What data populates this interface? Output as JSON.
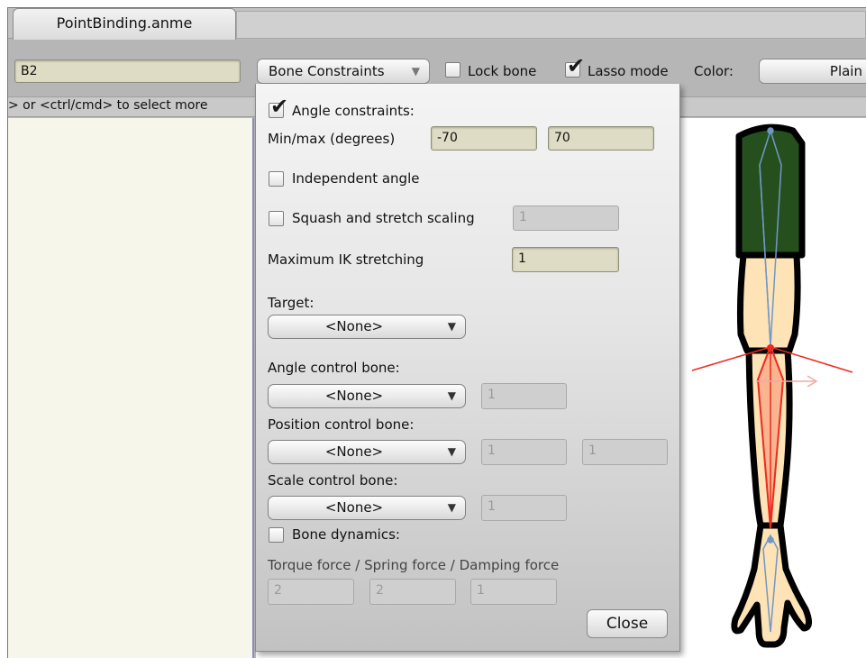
{
  "tab": {
    "title": "PointBinding.anme"
  },
  "toolbar": {
    "bone_name": "B2",
    "mode_dropdown": "Bone Constraints",
    "lock_bone_label": "Lock bone",
    "lock_bone_checked": false,
    "lasso_label": "Lasso mode",
    "lasso_checked": true,
    "color_label": "Color:",
    "color_value": "Plain"
  },
  "hint": "> or <ctrl/cmd> to select more",
  "popup": {
    "angle_constraints_label": "Angle constraints:",
    "angle_constraints_checked": true,
    "minmax_label": "Min/max (degrees)",
    "min_value": "-70",
    "max_value": "70",
    "independent_angle_label": "Independent angle",
    "squash_label": "Squash and stretch scaling",
    "squash_value": "1",
    "max_ik_label": "Maximum IK stretching",
    "max_ik_value": "1",
    "target_label": "Target:",
    "target_value": "<None>",
    "angle_control_label": "Angle control bone:",
    "angle_control_value": "<None>",
    "angle_control_num": "1",
    "position_control_label": "Position control bone:",
    "position_control_value": "<None>",
    "position_control_num1": "1",
    "position_control_num2": "1",
    "scale_control_label": "Scale control bone:",
    "scale_control_value": "<None>",
    "scale_control_num": "1",
    "bone_dynamics_label": "Bone dynamics:",
    "forces_label": "Torque force / Spring force / Damping force",
    "torque_value": "2",
    "spring_value": "2",
    "damping_value": "1",
    "close_label": "Close"
  },
  "colors": {
    "field_bg": "#dedcc4",
    "sleeve_green": "#25501d",
    "skin": "#fde3b6",
    "bone_blue": "#6f98c8",
    "bone_red": "#ee2a1f"
  }
}
